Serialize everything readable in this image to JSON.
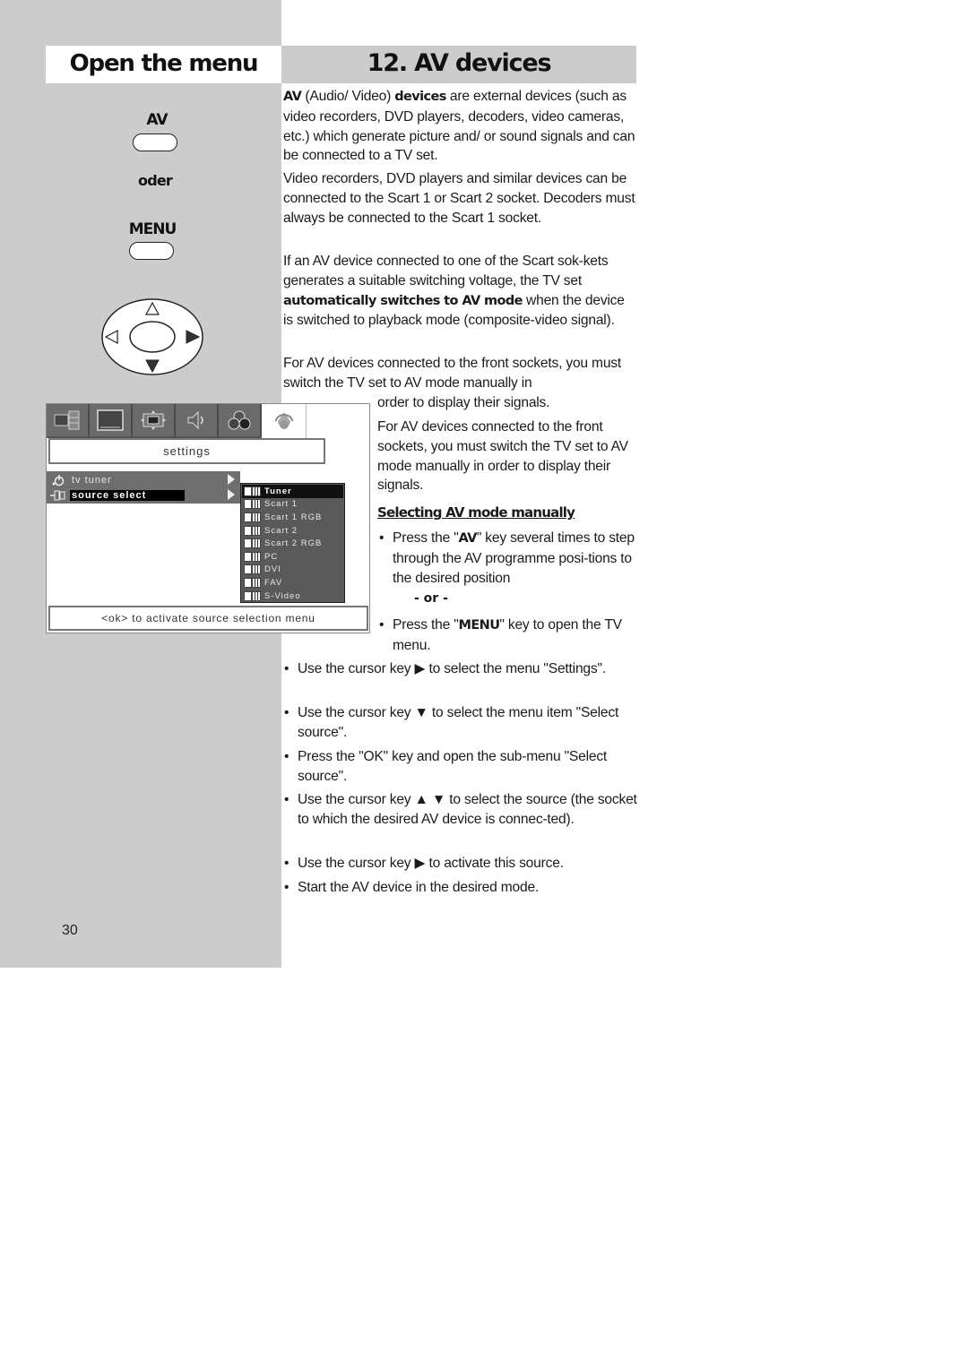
{
  "header": {
    "side_title": "Open the menu",
    "main_title": "12. AV devices"
  },
  "sidebar": {
    "key_av": "AV",
    "oder": "oder",
    "key_menu": "MENU"
  },
  "tv_menu": {
    "tabs": [
      {
        "icon": "picture-in-picture-icon",
        "active": false
      },
      {
        "icon": "screen-icon",
        "active": false
      },
      {
        "icon": "picture-format-icon",
        "active": false
      },
      {
        "icon": "speaker-icon",
        "active": false
      },
      {
        "icon": "color-icon",
        "active": false
      },
      {
        "icon": "settings-icon",
        "active": true
      }
    ],
    "title": "settings",
    "items": [
      {
        "icon": "tv-tuner-icon",
        "label": "tv tuner",
        "selected": false
      },
      {
        "icon": "source-select-icon",
        "label": "source select",
        "selected": true
      }
    ],
    "sources": [
      {
        "label": "Tuner",
        "selected": true
      },
      {
        "label": "Scart 1",
        "selected": false
      },
      {
        "label": "Scart 1 RGB",
        "selected": false
      },
      {
        "label": "Scart 2",
        "selected": false
      },
      {
        "label": "Scart 2 RGB",
        "selected": false
      },
      {
        "label": "PC",
        "selected": false
      },
      {
        "label": "DVI",
        "selected": false
      },
      {
        "label": "FAV",
        "selected": false
      },
      {
        "label": "S-Video",
        "selected": false
      }
    ],
    "hint": "<ok> to activate source selection menu"
  },
  "content": {
    "p1": {
      "b1": "AV",
      "t1": " (Audio/ Video) ",
      "b2": "devices",
      "t2": " are external devices (such as video recorders, DVD players, decoders, video cameras, etc.) which generate picture and/ or sound signals and can be connected to a TV set."
    },
    "p2": "Video recorders, DVD players and similar devices can be connected to the Scart 1 or Scart 2 socket. Decoders must always be connected to the Scart 1 socket.",
    "p3": {
      "t1": "If an AV device connected to one of the Scart sok-kets generates a suitable switching voltage, the TV set ",
      "b1": "automatically switches to AV mode",
      "t2": " when the device is switched to playback mode (composite-video signal)."
    },
    "p4a": "For AV devices connected to the front sockets, you must switch the TV set to AV mode manually in",
    "p4b": "order to display their signals.",
    "p5": "For AV devices connected to the front sockets, you must switch the TV set to AV mode manually in order to display their signals.",
    "subheading": "Selecting AV mode manually",
    "bullet_av": {
      "t1": "Press the \"",
      "b": "AV",
      "t2": "\" key several times to step through the AV programme posi-tions to the desired position"
    },
    "or": "- or -",
    "bullet_menu": {
      "t1": "Press the \"",
      "b": "MENU",
      "t2": "\" key to open the TV menu."
    },
    "steps": [
      "Use the cursor key ▶ to select the menu \"Settings\".",
      "Use the cursor key ▼ to select the menu item \"Select source\".",
      "Press the \"OK\" key and open the sub-menu \"Select source\".",
      "Use the cursor key ▲ ▼ to select the source (the socket to which the desired AV device is connec-ted).",
      "Use the cursor key ▶ to activate this source.",
      "Start the AV device in the desired mode."
    ],
    "bullet_char": "•"
  },
  "footer": {
    "page_number": "30"
  }
}
